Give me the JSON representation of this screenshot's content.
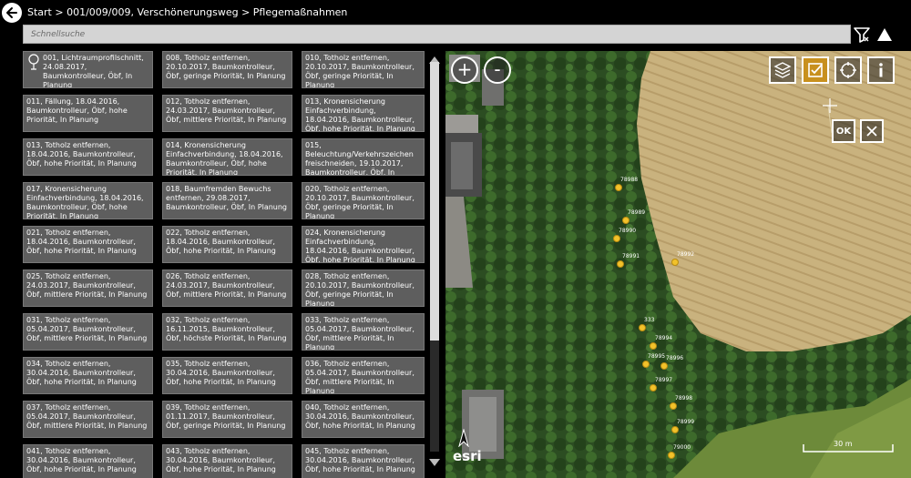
{
  "header": {
    "breadcrumb": "Start > 001/009/009, Verschönerungsweg > Pflegemaßnahmen"
  },
  "search": {
    "placeholder": "Schnellsuche"
  },
  "list": {
    "items": [
      {
        "text": "001, Lichtraumprofilschnitt, 24.08.2017, Baumkontrolleur, Öbf, In Planung",
        "icon": "tree-icon"
      },
      {
        "text": "008, Totholz entfernen, 20.10.2017, Baumkontrolleur, Öbf, geringe Priorität, In Planung"
      },
      {
        "text": "010, Totholz entfernen, 20.10.2017, Baumkontrolleur, Öbf, geringe Priorität, In Planung"
      },
      {
        "text": "011, Fällung, 18.04.2016, Baumkontrolleur, Öbf, hohe Priorität, In Planung"
      },
      {
        "text": "012, Totholz entfernen, 24.03.2017, Baumkontrolleur, Öbf, mittlere Priorität, In Planung"
      },
      {
        "text": "013, Kronensicherung Einfachverbindung, 18.04.2016, Baumkontrolleur, Öbf, hohe Priorität, In Planung"
      },
      {
        "text": "013, Totholz entfernen, 18.04.2016, Baumkontrolleur, Öbf, hohe Priorität, In Planung"
      },
      {
        "text": "014, Kronensicherung Einfachverbindung, 18.04.2016, Baumkontrolleur, Öbf, hohe Priorität, In Planung"
      },
      {
        "text": "015, Beleuchtung/Verkehrszeichen freischneiden, 19.10.2017, Baumkontrolleur, Öbf, In Planung"
      },
      {
        "text": "017, Kronensicherung Einfachverbindung, 18.04.2016, Baumkontrolleur, Öbf, hohe Priorität, In Planung"
      },
      {
        "text": "018, Baumfremden Bewuchs entfernen, 29.08.2017, Baumkontrolleur, Öbf, In Planung"
      },
      {
        "text": "020, Totholz entfernen, 20.10.2017, Baumkontrolleur, Öbf, geringe Priorität, In Planung"
      },
      {
        "text": "021, Totholz entfernen, 18.04.2016, Baumkontrolleur, Öbf, hohe Priorität, In Planung"
      },
      {
        "text": "022, Totholz entfernen, 18.04.2016, Baumkontrolleur, Öbf, hohe Priorität, In Planung"
      },
      {
        "text": "024, Kronensicherung Einfachverbindung, 18.04.2016, Baumkontrolleur, Öbf, hohe Priorität, In Planung"
      },
      {
        "text": "025, Totholz entfernen, 24.03.2017, Baumkontrolleur, Öbf, mittlere Priorität, In Planung"
      },
      {
        "text": "026, Totholz entfernen, 24.03.2017, Baumkontrolleur, Öbf, mittlere Priorität, In Planung"
      },
      {
        "text": "028, Totholz entfernen, 20.10.2017, Baumkontrolleur, Öbf, geringe Priorität, In Planung"
      },
      {
        "text": "031, Totholz entfernen, 05.04.2017, Baumkontrolleur, Öbf, mittlere Priorität, In Planung"
      },
      {
        "text": "032, Totholz entfernen, 16.11.2015, Baumkontrolleur, Öbf, höchste Priorität, In Planung"
      },
      {
        "text": "033, Totholz entfernen, 05.04.2017, Baumkontrolleur, Öbf, mittlere Priorität, In Planung"
      },
      {
        "text": "034, Totholz entfernen, 30.04.2016, Baumkontrolleur, Öbf, hohe Priorität, In Planung"
      },
      {
        "text": "035, Totholz entfernen, 30.04.2016, Baumkontrolleur, Öbf, hohe Priorität, In Planung"
      },
      {
        "text": "036, Totholz entfernen, 05.04.2017, Baumkontrolleur, Öbf, mittlere Priorität, In Planung"
      },
      {
        "text": "037, Totholz entfernen, 05.04.2017, Baumkontrolleur, Öbf, mittlere Priorität, In Planung"
      },
      {
        "text": "039, Totholz entfernen, 01.11.2017, Baumkontrolleur, Öbf, geringe Priorität, In Planung"
      },
      {
        "text": "040, Totholz entfernen, 30.04.2016, Baumkontrolleur, Öbf, hohe Priorität, In Planung"
      },
      {
        "text": "041, Totholz entfernen, 30.04.2016, Baumkontrolleur, Öbf, hohe Priorität, In Planung"
      },
      {
        "text": "043, Totholz entfernen, 30.04.2016, Baumkontrolleur, Öbf, hohe Priorität, In Planung"
      },
      {
        "text": "045, Totholz entfernen, 30.04.2016, Baumkontrolleur, Öbf, hohe Priorität, In Planung"
      }
    ]
  },
  "map": {
    "zoom_in_label": "+",
    "zoom_out_label": "-",
    "ok_label": "OK",
    "attribution": "esri",
    "scale_label": "30 m",
    "tools": [
      {
        "name": "layers-icon",
        "active": false
      },
      {
        "name": "checkbox-icon",
        "active": true,
        "accent": "#c8901e"
      },
      {
        "name": "target-icon",
        "active": false
      },
      {
        "name": "info-icon",
        "active": false
      }
    ],
    "markers": [
      {
        "label": "78988"
      },
      {
        "label": "78989"
      },
      {
        "label": "78990"
      },
      {
        "label": "78991"
      },
      {
        "label": "78992"
      },
      {
        "label": "333"
      },
      {
        "label": "78994"
      },
      {
        "label": "78995"
      },
      {
        "label": "78996"
      },
      {
        "label": "78997"
      },
      {
        "label": "78998"
      },
      {
        "label": "78999"
      },
      {
        "label": "79000"
      }
    ],
    "marker_color": "#f2c22b"
  }
}
